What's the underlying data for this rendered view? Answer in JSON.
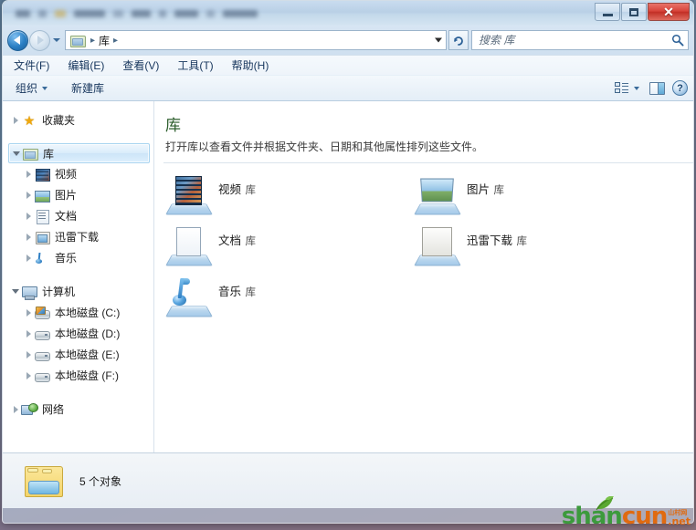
{
  "window": {
    "controls": {
      "minimize": "—",
      "maximize": "❐",
      "close": "✕"
    }
  },
  "address": {
    "back_tooltip": "后退",
    "forward_tooltip": "前进",
    "breadcrumb": [
      "库"
    ],
    "separator": "▸",
    "refresh": "↻"
  },
  "search": {
    "placeholder": "搜索 库",
    "value": "",
    "icon": "search-icon"
  },
  "menubar": {
    "items": [
      {
        "label": "文件(F)"
      },
      {
        "label": "编辑(E)"
      },
      {
        "label": "查看(V)"
      },
      {
        "label": "工具(T)"
      },
      {
        "label": "帮助(H)"
      }
    ]
  },
  "toolbar": {
    "organize_label": "组织",
    "new_library_label": "新建库",
    "help_glyph": "?"
  },
  "sidebar": {
    "groups": [
      {
        "header": {
          "label": "收藏夹",
          "icon": "star-icon",
          "expander": "closed"
        },
        "items": []
      },
      {
        "header": {
          "label": "库",
          "icon": "folder-icon",
          "expander": "open",
          "selected": true
        },
        "items": [
          {
            "label": "视频",
            "icon": "film-icon"
          },
          {
            "label": "图片",
            "icon": "picture-icon"
          },
          {
            "label": "文档",
            "icon": "document-icon"
          },
          {
            "label": "迅雷下载",
            "icon": "download-icon"
          },
          {
            "label": "音乐",
            "icon": "music-note-icon"
          }
        ]
      },
      {
        "header": {
          "label": "计算机",
          "icon": "computer-icon",
          "expander": "open"
        },
        "items": [
          {
            "label": "本地磁盘 (C:)",
            "icon": "system-drive-icon"
          },
          {
            "label": "本地磁盘 (D:)",
            "icon": "drive-icon"
          },
          {
            "label": "本地磁盘 (E:)",
            "icon": "drive-icon"
          },
          {
            "label": "本地磁盘 (F:)",
            "icon": "drive-icon"
          }
        ]
      },
      {
        "header": {
          "label": "网络",
          "icon": "network-icon",
          "expander": "closed"
        },
        "items": []
      }
    ]
  },
  "main": {
    "title": "库",
    "description": "打开库以查看文件并根据文件夹、日期和其他属性排列这些文件。",
    "items": [
      {
        "name": "视频",
        "subtitle": "库",
        "icon": "video-library-icon"
      },
      {
        "name": "图片",
        "subtitle": "库",
        "icon": "pictures-library-icon"
      },
      {
        "name": "文档",
        "subtitle": "库",
        "icon": "documents-library-icon"
      },
      {
        "name": "迅雷下载",
        "subtitle": "库",
        "icon": "downloads-library-icon"
      },
      {
        "name": "音乐",
        "subtitle": "库",
        "icon": "music-library-icon"
      }
    ]
  },
  "status": {
    "text": "5 个对象",
    "icon": "libraries-folder-icon"
  },
  "watermark": {
    "part1": "shan",
    "part2": "cun",
    "suffix": ".net",
    "cn": "山村网"
  },
  "colors": {
    "title_accent": "#2a5c2a",
    "close_button": "#c22f26",
    "selection": "#cde5f8",
    "watermark_green": "#3c9a3c",
    "watermark_orange": "#e06a10"
  }
}
